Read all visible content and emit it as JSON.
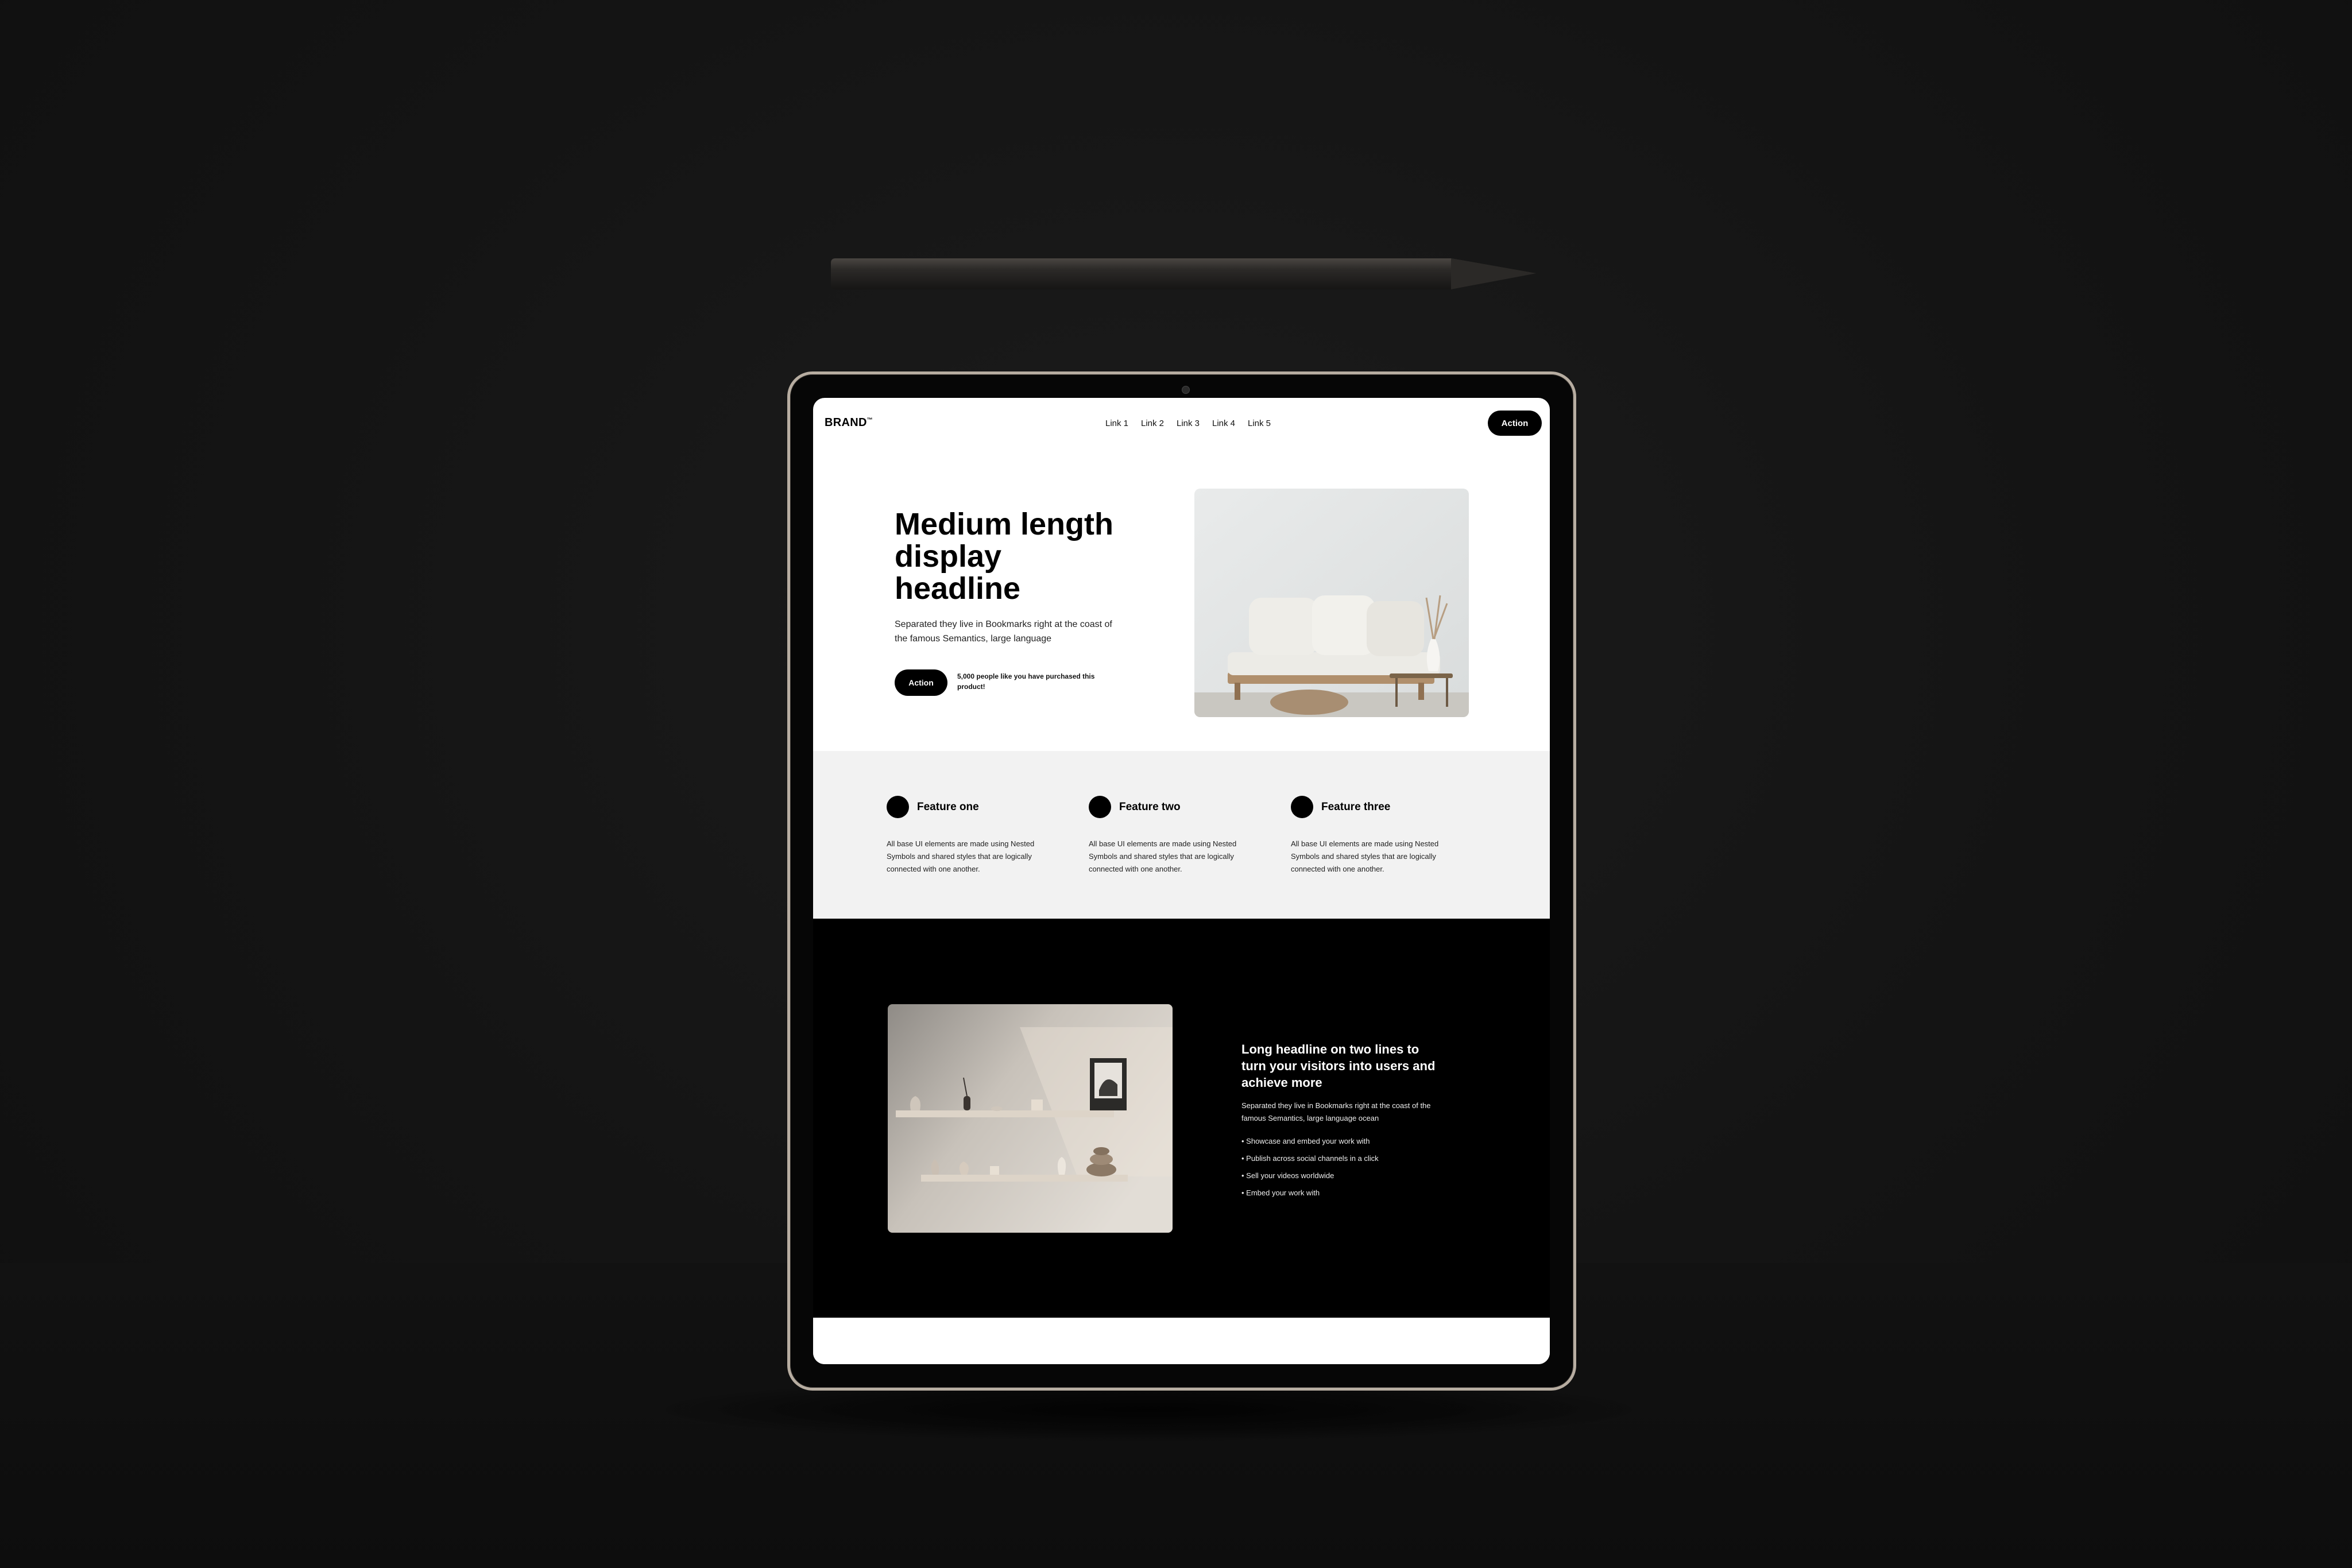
{
  "nav": {
    "brand": "BRAND",
    "brand_mark": "™",
    "links": [
      "Link 1",
      "Link 2",
      "Link 3",
      "Link 4",
      "Link 5"
    ],
    "action_label": "Action"
  },
  "hero": {
    "title_lines": [
      "Medium length",
      "display",
      "headline"
    ],
    "subtitle_lines": [
      "Separated they live in Bookmarks right at the coast of",
      "the famous Semantics, large language"
    ],
    "action_label": "Action",
    "social_proof_lines": [
      "5,000 people like you have purchased this",
      "product!"
    ]
  },
  "features": [
    {
      "title": "Feature one",
      "text_lines": [
        "All base UI elements are made using Nested",
        "Symbols and shared styles that are logically",
        "connected with one another."
      ]
    },
    {
      "title": "Feature two",
      "text_lines": [
        "All base UI elements are made using Nested",
        "Symbols and shared styles that are logically",
        "connected with one another."
      ]
    },
    {
      "title": "Feature three",
      "text_lines": [
        "All base UI elements are made using Nested",
        "Symbols and shared styles that are logically",
        "connected with one another."
      ]
    }
  ],
  "promo": {
    "title_lines": [
      "Long headline on two lines to",
      "turn your visitors into users and",
      "achieve more"
    ],
    "subtitle_lines": [
      "Separated they live in Bookmarks right at the coast of the",
      "famous Semantics, large language ocean"
    ],
    "bullets": [
      "• Showcase and embed your work with",
      "• Publish across social channels in a click",
      "• Sell your videos worldwide",
      "• Embed your work with"
    ]
  },
  "colors": {
    "background": "#151515",
    "tablet_frame": "#b7ada1",
    "accent": "#000000",
    "features_bg": "#f2f2f2"
  }
}
